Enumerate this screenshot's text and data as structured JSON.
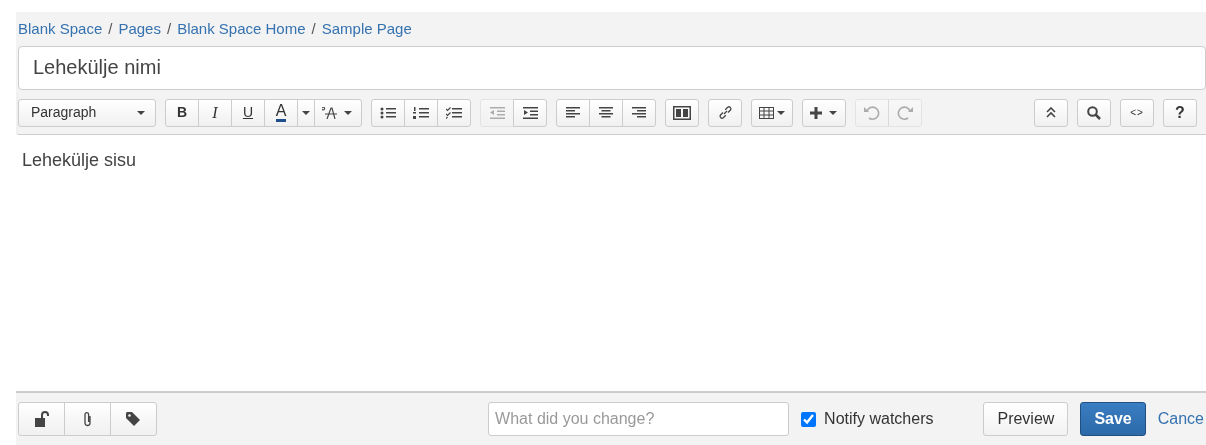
{
  "breadcrumbs": [
    {
      "label": "Blank Space"
    },
    {
      "label": "Pages"
    },
    {
      "label": "Blank Space Home"
    },
    {
      "label": "Sample Page"
    }
  ],
  "breadcrumb_separator": "/",
  "title_field": {
    "value": "Lehekülje nimi"
  },
  "toolbar": {
    "left": [
      [
        {
          "kind": "select",
          "label": "Paragraph",
          "disabled": false
        }
      ],
      [
        {
          "kind": "bold",
          "label": "B",
          "disabled": false
        },
        {
          "kind": "italic",
          "label": "I",
          "disabled": false
        },
        {
          "kind": "underline",
          "label": "U",
          "disabled": false
        },
        {
          "kind": "color",
          "label": "A",
          "disabled": false
        },
        {
          "kind": "caret",
          "disabled": false
        },
        {
          "kind": "clear-format",
          "disabled": false
        }
      ],
      [
        {
          "kind": "bullets",
          "disabled": false
        },
        {
          "kind": "numbers",
          "disabled": false
        },
        {
          "kind": "tasks",
          "disabled": false
        }
      ],
      [
        {
          "kind": "outdent",
          "disabled": true
        },
        {
          "kind": "indent",
          "disabled": false
        }
      ],
      [
        {
          "kind": "align-left",
          "disabled": false
        },
        {
          "kind": "align-center",
          "disabled": false
        },
        {
          "kind": "align-right",
          "disabled": false
        }
      ],
      [
        {
          "kind": "layout",
          "disabled": false
        }
      ],
      [
        {
          "kind": "link",
          "disabled": false
        }
      ],
      [
        {
          "kind": "table",
          "disabled": false
        }
      ],
      [
        {
          "kind": "insert",
          "disabled": false
        }
      ],
      [
        {
          "kind": "undo",
          "disabled": true
        },
        {
          "kind": "redo",
          "disabled": true
        }
      ]
    ],
    "right": [
      [
        {
          "kind": "collapse",
          "disabled": false
        }
      ],
      [
        {
          "kind": "search",
          "disabled": false
        }
      ],
      [
        {
          "kind": "source",
          "label": "<>",
          "disabled": false
        }
      ],
      [
        {
          "kind": "help",
          "label": "?",
          "disabled": false
        }
      ]
    ]
  },
  "editor": {
    "content": "Lehekülje sisu"
  },
  "footer": {
    "tools": [
      {
        "kind": "restrictions"
      },
      {
        "kind": "attachments"
      },
      {
        "kind": "labels"
      }
    ],
    "comment": {
      "placeholder": "What did you change?"
    },
    "notify": {
      "label": "Notify watchers",
      "checked": true
    },
    "buttons": [
      {
        "kind": "secondary",
        "label": "Preview"
      },
      {
        "kind": "primary",
        "label": "Save"
      },
      {
        "kind": "link",
        "label": "Cance"
      }
    ]
  }
}
